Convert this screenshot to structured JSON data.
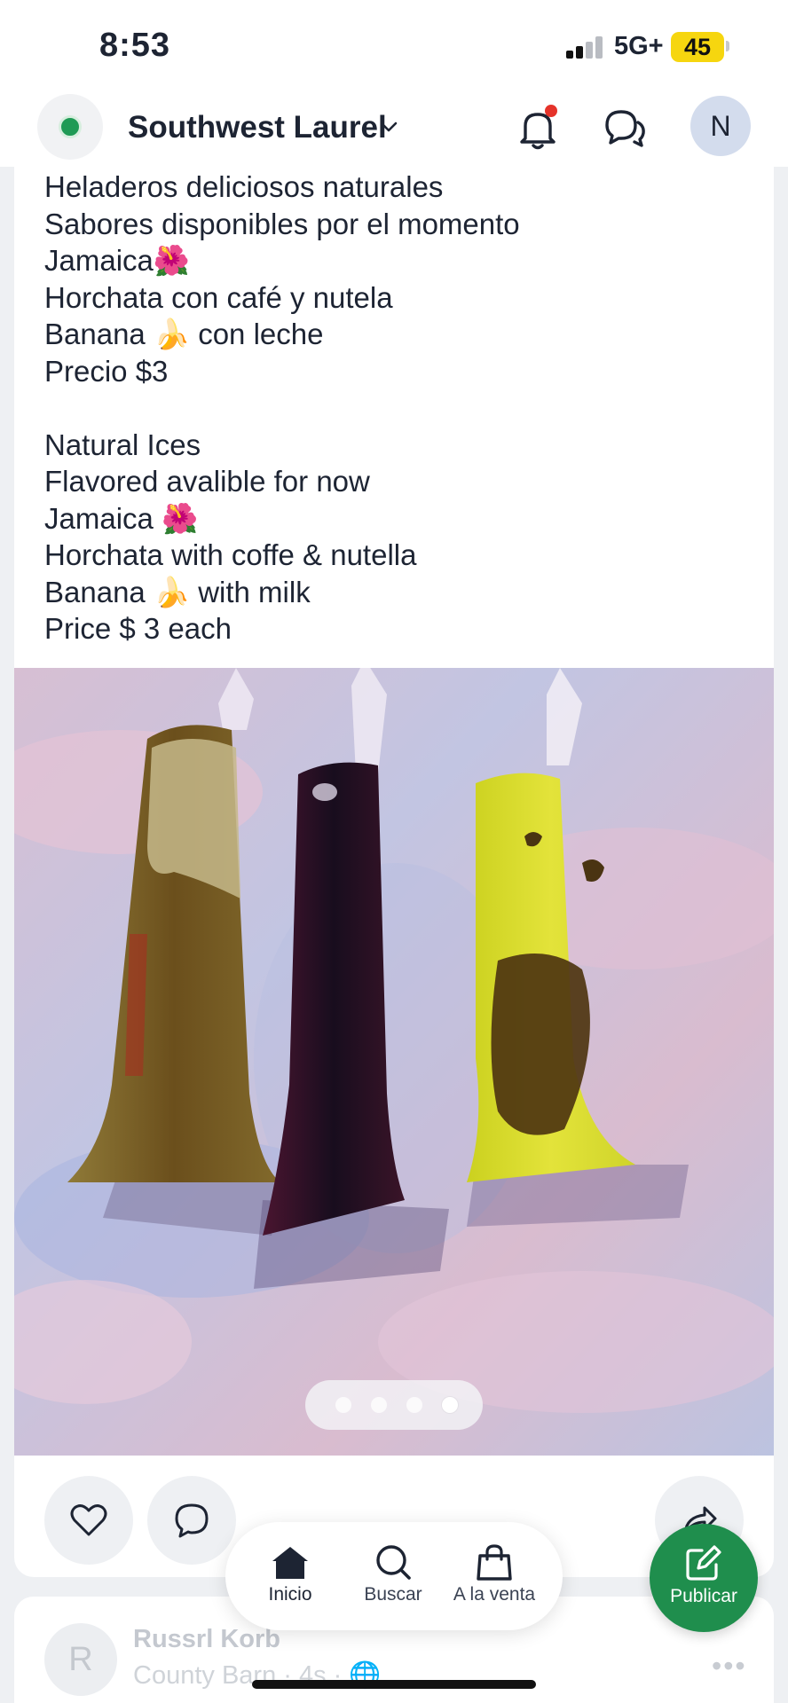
{
  "status_bar": {
    "time": "8:53",
    "network": "5G+",
    "battery": "45"
  },
  "header": {
    "location": "Southwest Laurel",
    "avatar_initial": "N",
    "icons": [
      "location-dot-icon",
      "chevron-down-icon",
      "bell-icon",
      "chat-icon"
    ]
  },
  "post": {
    "lines": [
      "Heladeros deliciosos naturales",
      "Sabores disponibles por el momento",
      "Jamaica🌺",
      "Horchata con café y nutela",
      "Banana 🍌 con leche",
      "Precio $3",
      "",
      "Natural Ices",
      "Flavored avalible for now",
      "Jamaica 🌺",
      "Horchata with coffe & nutella",
      "Banana 🍌 with milk",
      "Price $ 3 each"
    ],
    "carousel": {
      "count": 4,
      "active_index": 3
    }
  },
  "next_post": {
    "avatar_initial": "R",
    "author": "Russrl Korb",
    "meta": "County Barn · 4s · 🌐",
    "more": "•••"
  },
  "bottom_nav": {
    "items": [
      {
        "label": "Inicio",
        "icon": "home-icon",
        "active": true
      },
      {
        "label": "Buscar",
        "icon": "search-icon",
        "active": false
      },
      {
        "label": "A la venta",
        "icon": "shopping-bag-icon",
        "active": false
      }
    ],
    "publish_label": "Publicar"
  },
  "colors": {
    "brand_green": "#1f8e4d",
    "notification_red": "#e5332a",
    "battery_yellow": "#f6d60f"
  }
}
